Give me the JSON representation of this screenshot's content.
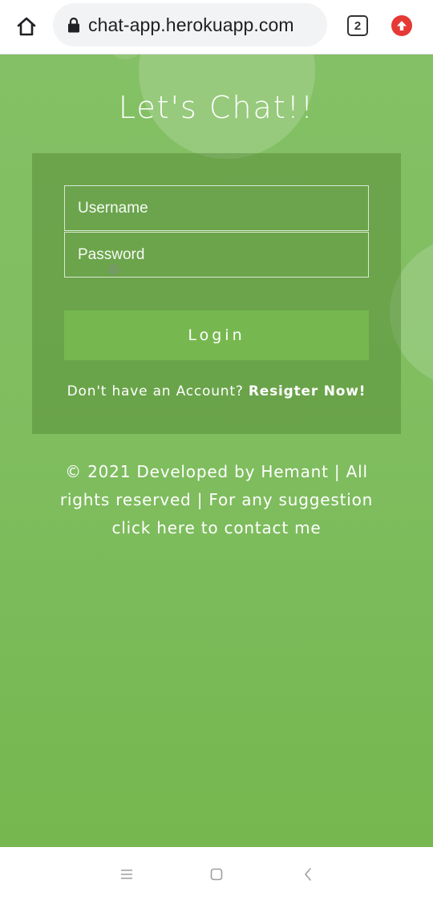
{
  "browser": {
    "url": "chat-app.herokuapp.com",
    "tab_count": "2",
    "icons": {
      "home": "home-icon",
      "lock": "lock-icon",
      "update": "arrow-up-icon"
    },
    "update_color": "#e53935"
  },
  "page": {
    "title": "Let's Chat!!",
    "background_color": "#7fbd5f",
    "form": {
      "username_placeholder": "Username",
      "password_placeholder": "Password",
      "login_label": "Login",
      "signup_prompt": "Don't have an Account?",
      "signup_link": "Resigter Now!"
    },
    "footer": {
      "copyright": "© 2021 Developed by Hemant | All rights reserved |",
      "contact": "For any suggestion click here to contact me"
    }
  },
  "nav_bar": {
    "icons": [
      "menu-icon",
      "square-home-icon",
      "back-chevron-icon"
    ]
  }
}
